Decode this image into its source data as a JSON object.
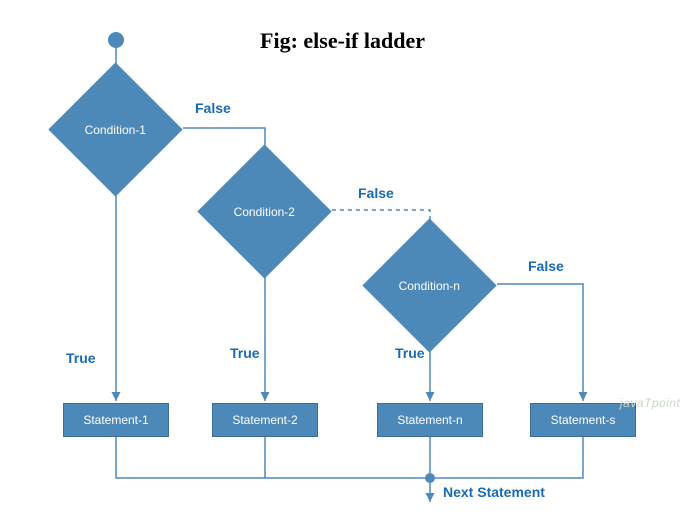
{
  "title": "Fig: else-if ladder",
  "conditions": {
    "c1": "Condition-1",
    "c2": "Condition-2",
    "cn": "Condition-n"
  },
  "statements": {
    "s1": "Statement-1",
    "s2": "Statement-2",
    "sn": "Statement-n",
    "ss": "Statement-s"
  },
  "labels": {
    "true": "True",
    "false": "False",
    "next": "Next Statement"
  },
  "watermark": "javaTpoint"
}
